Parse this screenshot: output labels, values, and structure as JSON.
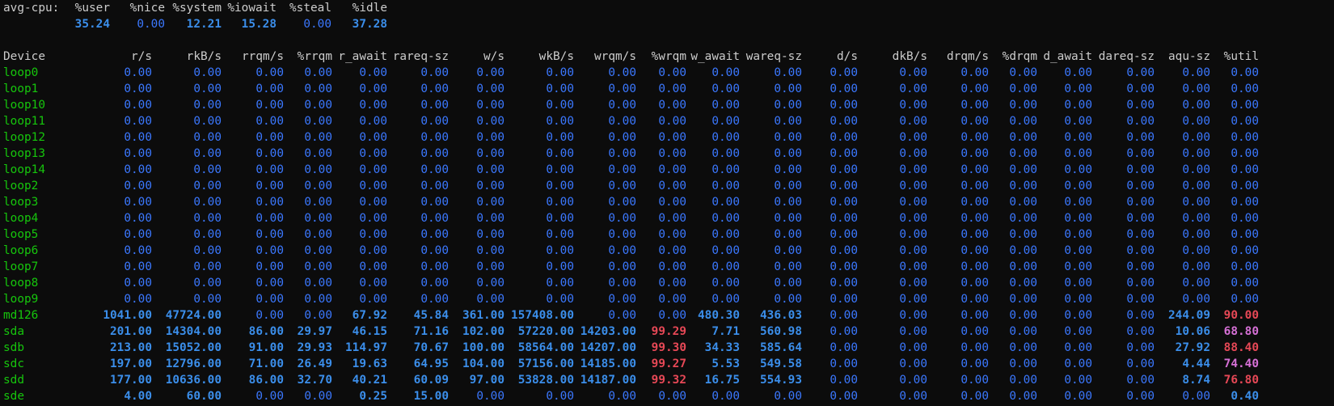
{
  "cpu": {
    "label": "avg-cpu:",
    "headers": [
      "%user",
      "%nice",
      "%system",
      "%iowait",
      "%steal",
      "%idle"
    ],
    "values": [
      {
        "v": "35.24",
        "s": "b"
      },
      {
        "v": "0.00",
        "s": "z"
      },
      {
        "v": "12.21",
        "s": "b"
      },
      {
        "v": "15.28",
        "s": "b"
      },
      {
        "v": "0.00",
        "s": "z"
      },
      {
        "v": "37.28",
        "s": "b"
      }
    ]
  },
  "device_table": {
    "columns": [
      "Device",
      "r/s",
      "rkB/s",
      "rrqm/s",
      "%rrqm",
      "r_await",
      "rareq-sz",
      "w/s",
      "wkB/s",
      "wrqm/s",
      "%wrqm",
      "w_await",
      "wareq-sz",
      "d/s",
      "dkB/s",
      "drqm/s",
      "%drqm",
      "d_await",
      "dareq-sz",
      "aqu-sz",
      "%util"
    ],
    "rows": [
      {
        "name": "loop0",
        "cells": [
          "0.00",
          "0.00",
          "0.00",
          "0.00",
          "0.00",
          "0.00",
          "0.00",
          "0.00",
          "0.00",
          "0.00",
          "0.00",
          "0.00",
          "0.00",
          "0.00",
          "0.00",
          "0.00",
          "0.00",
          "0.00",
          "0.00",
          "0.00"
        ],
        "styles": [
          "z",
          "z",
          "z",
          "z",
          "z",
          "z",
          "z",
          "z",
          "z",
          "z",
          "z",
          "z",
          "z",
          "z",
          "z",
          "z",
          "z",
          "z",
          "z",
          "z"
        ]
      },
      {
        "name": "loop1",
        "cells": [
          "0.00",
          "0.00",
          "0.00",
          "0.00",
          "0.00",
          "0.00",
          "0.00",
          "0.00",
          "0.00",
          "0.00",
          "0.00",
          "0.00",
          "0.00",
          "0.00",
          "0.00",
          "0.00",
          "0.00",
          "0.00",
          "0.00",
          "0.00"
        ],
        "styles": [
          "z",
          "z",
          "z",
          "z",
          "z",
          "z",
          "z",
          "z",
          "z",
          "z",
          "z",
          "z",
          "z",
          "z",
          "z",
          "z",
          "z",
          "z",
          "z",
          "z"
        ]
      },
      {
        "name": "loop10",
        "cells": [
          "0.00",
          "0.00",
          "0.00",
          "0.00",
          "0.00",
          "0.00",
          "0.00",
          "0.00",
          "0.00",
          "0.00",
          "0.00",
          "0.00",
          "0.00",
          "0.00",
          "0.00",
          "0.00",
          "0.00",
          "0.00",
          "0.00",
          "0.00"
        ],
        "styles": [
          "z",
          "z",
          "z",
          "z",
          "z",
          "z",
          "z",
          "z",
          "z",
          "z",
          "z",
          "z",
          "z",
          "z",
          "z",
          "z",
          "z",
          "z",
          "z",
          "z"
        ]
      },
      {
        "name": "loop11",
        "cells": [
          "0.00",
          "0.00",
          "0.00",
          "0.00",
          "0.00",
          "0.00",
          "0.00",
          "0.00",
          "0.00",
          "0.00",
          "0.00",
          "0.00",
          "0.00",
          "0.00",
          "0.00",
          "0.00",
          "0.00",
          "0.00",
          "0.00",
          "0.00"
        ],
        "styles": [
          "z",
          "z",
          "z",
          "z",
          "z",
          "z",
          "z",
          "z",
          "z",
          "z",
          "z",
          "z",
          "z",
          "z",
          "z",
          "z",
          "z",
          "z",
          "z",
          "z"
        ]
      },
      {
        "name": "loop12",
        "cells": [
          "0.00",
          "0.00",
          "0.00",
          "0.00",
          "0.00",
          "0.00",
          "0.00",
          "0.00",
          "0.00",
          "0.00",
          "0.00",
          "0.00",
          "0.00",
          "0.00",
          "0.00",
          "0.00",
          "0.00",
          "0.00",
          "0.00",
          "0.00"
        ],
        "styles": [
          "z",
          "z",
          "z",
          "z",
          "z",
          "z",
          "z",
          "z",
          "z",
          "z",
          "z",
          "z",
          "z",
          "z",
          "z",
          "z",
          "z",
          "z",
          "z",
          "z"
        ]
      },
      {
        "name": "loop13",
        "cells": [
          "0.00",
          "0.00",
          "0.00",
          "0.00",
          "0.00",
          "0.00",
          "0.00",
          "0.00",
          "0.00",
          "0.00",
          "0.00",
          "0.00",
          "0.00",
          "0.00",
          "0.00",
          "0.00",
          "0.00",
          "0.00",
          "0.00",
          "0.00"
        ],
        "styles": [
          "z",
          "z",
          "z",
          "z",
          "z",
          "z",
          "z",
          "z",
          "z",
          "z",
          "z",
          "z",
          "z",
          "z",
          "z",
          "z",
          "z",
          "z",
          "z",
          "z"
        ]
      },
      {
        "name": "loop14",
        "cells": [
          "0.00",
          "0.00",
          "0.00",
          "0.00",
          "0.00",
          "0.00",
          "0.00",
          "0.00",
          "0.00",
          "0.00",
          "0.00",
          "0.00",
          "0.00",
          "0.00",
          "0.00",
          "0.00",
          "0.00",
          "0.00",
          "0.00",
          "0.00"
        ],
        "styles": [
          "z",
          "z",
          "z",
          "z",
          "z",
          "z",
          "z",
          "z",
          "z",
          "z",
          "z",
          "z",
          "z",
          "z",
          "z",
          "z",
          "z",
          "z",
          "z",
          "z"
        ]
      },
      {
        "name": "loop2",
        "cells": [
          "0.00",
          "0.00",
          "0.00",
          "0.00",
          "0.00",
          "0.00",
          "0.00",
          "0.00",
          "0.00",
          "0.00",
          "0.00",
          "0.00",
          "0.00",
          "0.00",
          "0.00",
          "0.00",
          "0.00",
          "0.00",
          "0.00",
          "0.00"
        ],
        "styles": [
          "z",
          "z",
          "z",
          "z",
          "z",
          "z",
          "z",
          "z",
          "z",
          "z",
          "z",
          "z",
          "z",
          "z",
          "z",
          "z",
          "z",
          "z",
          "z",
          "z"
        ]
      },
      {
        "name": "loop3",
        "cells": [
          "0.00",
          "0.00",
          "0.00",
          "0.00",
          "0.00",
          "0.00",
          "0.00",
          "0.00",
          "0.00",
          "0.00",
          "0.00",
          "0.00",
          "0.00",
          "0.00",
          "0.00",
          "0.00",
          "0.00",
          "0.00",
          "0.00",
          "0.00"
        ],
        "styles": [
          "z",
          "z",
          "z",
          "z",
          "z",
          "z",
          "z",
          "z",
          "z",
          "z",
          "z",
          "z",
          "z",
          "z",
          "z",
          "z",
          "z",
          "z",
          "z",
          "z"
        ]
      },
      {
        "name": "loop4",
        "cells": [
          "0.00",
          "0.00",
          "0.00",
          "0.00",
          "0.00",
          "0.00",
          "0.00",
          "0.00",
          "0.00",
          "0.00",
          "0.00",
          "0.00",
          "0.00",
          "0.00",
          "0.00",
          "0.00",
          "0.00",
          "0.00",
          "0.00",
          "0.00"
        ],
        "styles": [
          "z",
          "z",
          "z",
          "z",
          "z",
          "z",
          "z",
          "z",
          "z",
          "z",
          "z",
          "z",
          "z",
          "z",
          "z",
          "z",
          "z",
          "z",
          "z",
          "z"
        ]
      },
      {
        "name": "loop5",
        "cells": [
          "0.00",
          "0.00",
          "0.00",
          "0.00",
          "0.00",
          "0.00",
          "0.00",
          "0.00",
          "0.00",
          "0.00",
          "0.00",
          "0.00",
          "0.00",
          "0.00",
          "0.00",
          "0.00",
          "0.00",
          "0.00",
          "0.00",
          "0.00"
        ],
        "styles": [
          "z",
          "z",
          "z",
          "z",
          "z",
          "z",
          "z",
          "z",
          "z",
          "z",
          "z",
          "z",
          "z",
          "z",
          "z",
          "z",
          "z",
          "z",
          "z",
          "z"
        ]
      },
      {
        "name": "loop6",
        "cells": [
          "0.00",
          "0.00",
          "0.00",
          "0.00",
          "0.00",
          "0.00",
          "0.00",
          "0.00",
          "0.00",
          "0.00",
          "0.00",
          "0.00",
          "0.00",
          "0.00",
          "0.00",
          "0.00",
          "0.00",
          "0.00",
          "0.00",
          "0.00"
        ],
        "styles": [
          "z",
          "z",
          "z",
          "z",
          "z",
          "z",
          "z",
          "z",
          "z",
          "z",
          "z",
          "z",
          "z",
          "z",
          "z",
          "z",
          "z",
          "z",
          "z",
          "z"
        ]
      },
      {
        "name": "loop7",
        "cells": [
          "0.00",
          "0.00",
          "0.00",
          "0.00",
          "0.00",
          "0.00",
          "0.00",
          "0.00",
          "0.00",
          "0.00",
          "0.00",
          "0.00",
          "0.00",
          "0.00",
          "0.00",
          "0.00",
          "0.00",
          "0.00",
          "0.00",
          "0.00"
        ],
        "styles": [
          "z",
          "z",
          "z",
          "z",
          "z",
          "z",
          "z",
          "z",
          "z",
          "z",
          "z",
          "z",
          "z",
          "z",
          "z",
          "z",
          "z",
          "z",
          "z",
          "z"
        ]
      },
      {
        "name": "loop8",
        "cells": [
          "0.00",
          "0.00",
          "0.00",
          "0.00",
          "0.00",
          "0.00",
          "0.00",
          "0.00",
          "0.00",
          "0.00",
          "0.00",
          "0.00",
          "0.00",
          "0.00",
          "0.00",
          "0.00",
          "0.00",
          "0.00",
          "0.00",
          "0.00"
        ],
        "styles": [
          "z",
          "z",
          "z",
          "z",
          "z",
          "z",
          "z",
          "z",
          "z",
          "z",
          "z",
          "z",
          "z",
          "z",
          "z",
          "z",
          "z",
          "z",
          "z",
          "z"
        ]
      },
      {
        "name": "loop9",
        "cells": [
          "0.00",
          "0.00",
          "0.00",
          "0.00",
          "0.00",
          "0.00",
          "0.00",
          "0.00",
          "0.00",
          "0.00",
          "0.00",
          "0.00",
          "0.00",
          "0.00",
          "0.00",
          "0.00",
          "0.00",
          "0.00",
          "0.00",
          "0.00"
        ],
        "styles": [
          "z",
          "z",
          "z",
          "z",
          "z",
          "z",
          "z",
          "z",
          "z",
          "z",
          "z",
          "z",
          "z",
          "z",
          "z",
          "z",
          "z",
          "z",
          "z",
          "z"
        ]
      },
      {
        "name": "md126",
        "cells": [
          "1041.00",
          "47724.00",
          "0.00",
          "0.00",
          "67.92",
          "45.84",
          "361.00",
          "157408.00",
          "0.00",
          "0.00",
          "480.30",
          "436.03",
          "0.00",
          "0.00",
          "0.00",
          "0.00",
          "0.00",
          "0.00",
          "244.09",
          "90.00"
        ],
        "styles": [
          "b",
          "b",
          "z",
          "z",
          "b",
          "b",
          "b",
          "b",
          "z",
          "z",
          "b",
          "b",
          "z",
          "z",
          "z",
          "z",
          "z",
          "z",
          "b",
          "red"
        ]
      },
      {
        "name": "sda",
        "cells": [
          "201.00",
          "14304.00",
          "86.00",
          "29.97",
          "46.15",
          "71.16",
          "102.00",
          "57220.00",
          "14203.00",
          "99.29",
          "7.71",
          "560.98",
          "0.00",
          "0.00",
          "0.00",
          "0.00",
          "0.00",
          "0.00",
          "10.06",
          "68.80"
        ],
        "styles": [
          "b",
          "b",
          "b",
          "b",
          "b",
          "b",
          "b",
          "b",
          "b",
          "red",
          "b",
          "b",
          "z",
          "z",
          "z",
          "z",
          "z",
          "z",
          "b",
          "mag"
        ]
      },
      {
        "name": "sdb",
        "cells": [
          "213.00",
          "15052.00",
          "91.00",
          "29.93",
          "114.97",
          "70.67",
          "100.00",
          "58564.00",
          "14207.00",
          "99.30",
          "34.33",
          "585.64",
          "0.00",
          "0.00",
          "0.00",
          "0.00",
          "0.00",
          "0.00",
          "27.92",
          "88.40"
        ],
        "styles": [
          "b",
          "b",
          "b",
          "b",
          "b",
          "b",
          "b",
          "b",
          "b",
          "red",
          "b",
          "b",
          "z",
          "z",
          "z",
          "z",
          "z",
          "z",
          "b",
          "red"
        ]
      },
      {
        "name": "sdc",
        "cells": [
          "197.00",
          "12796.00",
          "71.00",
          "26.49",
          "19.63",
          "64.95",
          "104.00",
          "57156.00",
          "14185.00",
          "99.27",
          "5.53",
          "549.58",
          "0.00",
          "0.00",
          "0.00",
          "0.00",
          "0.00",
          "0.00",
          "4.44",
          "74.40"
        ],
        "styles": [
          "b",
          "b",
          "b",
          "b",
          "b",
          "b",
          "b",
          "b",
          "b",
          "red",
          "b",
          "b",
          "z",
          "z",
          "z",
          "z",
          "z",
          "z",
          "b",
          "mag"
        ]
      },
      {
        "name": "sdd",
        "cells": [
          "177.00",
          "10636.00",
          "86.00",
          "32.70",
          "40.21",
          "60.09",
          "97.00",
          "53828.00",
          "14187.00",
          "99.32",
          "16.75",
          "554.93",
          "0.00",
          "0.00",
          "0.00",
          "0.00",
          "0.00",
          "0.00",
          "8.74",
          "76.80"
        ],
        "styles": [
          "b",
          "b",
          "b",
          "b",
          "b",
          "b",
          "b",
          "b",
          "b",
          "red",
          "b",
          "b",
          "z",
          "z",
          "z",
          "z",
          "z",
          "z",
          "b",
          "red"
        ]
      },
      {
        "name": "sde",
        "cells": [
          "4.00",
          "60.00",
          "0.00",
          "0.00",
          "0.25",
          "15.00",
          "0.00",
          "0.00",
          "0.00",
          "0.00",
          "0.00",
          "0.00",
          "0.00",
          "0.00",
          "0.00",
          "0.00",
          "0.00",
          "0.00",
          "0.00",
          "0.40"
        ],
        "styles": [
          "b",
          "b",
          "z",
          "z",
          "b",
          "b",
          "z",
          "z",
          "z",
          "z",
          "z",
          "z",
          "z",
          "z",
          "z",
          "z",
          "z",
          "z",
          "z",
          "b"
        ]
      }
    ]
  },
  "colors": {
    "background": "#0c0c0c",
    "header_text": "#cccccc",
    "device_name": "#16c60c",
    "zero_value": "#3b78ff",
    "active_value": "#3b8eea",
    "high_value": "#e74856",
    "util_medium": "#d670d6"
  }
}
